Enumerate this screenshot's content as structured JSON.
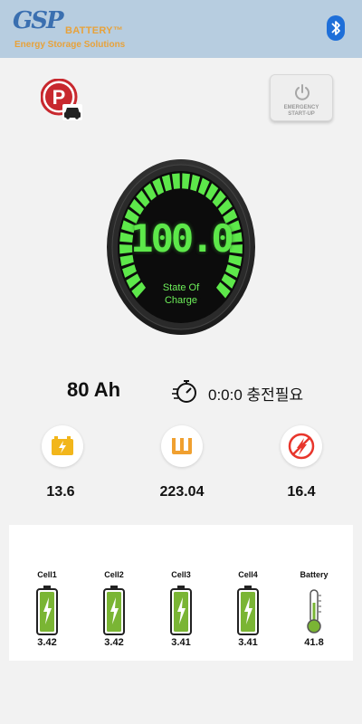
{
  "header": {
    "logo_mark": "GSP",
    "logo_battery": "BATTERY™",
    "logo_tagline": "Energy Storage Solutions",
    "bluetooth_icon": "bluetooth-icon"
  },
  "controls": {
    "parking_icon": "parking-car-icon",
    "emergency_line1": "EMERGENCY",
    "emergency_line2": "START-UP",
    "power_icon": "power-icon"
  },
  "gauge": {
    "value": "100.0",
    "label_line1": "State Of",
    "label_line2": "Charge",
    "level_percent": 100,
    "segment_color": "#5de84a"
  },
  "summary": {
    "capacity": "80 Ah",
    "timer_icon": "stopwatch-icon",
    "charge_time": "0:0:0 충전필요"
  },
  "stats": [
    {
      "icon": "battery-charge-icon",
      "value": "13.6",
      "color": "#f2b61b"
    },
    {
      "icon": "watt-icon",
      "value": "223.04",
      "color": "#f0a030"
    },
    {
      "icon": "current-bolt-icon",
      "value": "16.4",
      "color": "#e8362c"
    }
  ],
  "cells": [
    {
      "name": "Cell1",
      "value": "3.42",
      "icon": "battery-cell-icon"
    },
    {
      "name": "Cell2",
      "value": "3.42",
      "icon": "battery-cell-icon"
    },
    {
      "name": "Cell3",
      "value": "3.41",
      "icon": "battery-cell-icon"
    },
    {
      "name": "Cell4",
      "value": "3.41",
      "icon": "battery-cell-icon"
    },
    {
      "name": "Battery",
      "value": "41.8",
      "icon": "thermometer-icon"
    }
  ]
}
